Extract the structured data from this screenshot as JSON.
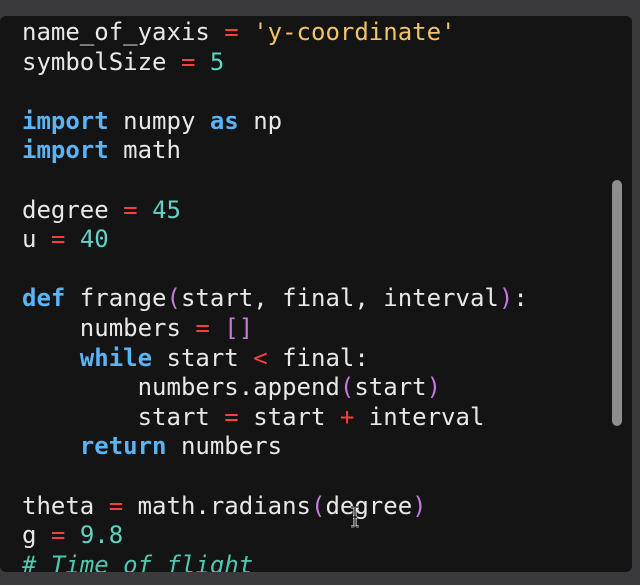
{
  "editor": {
    "lines": [
      {
        "tokens": [
          {
            "t": "name_of_yaxis ",
            "c": ""
          },
          {
            "t": "=",
            "c": "op"
          },
          {
            "t": " ",
            "c": ""
          },
          {
            "t": "'y-coordinate'",
            "c": "str"
          }
        ]
      },
      {
        "tokens": [
          {
            "t": "symbolSize ",
            "c": ""
          },
          {
            "t": "=",
            "c": "op"
          },
          {
            "t": " ",
            "c": ""
          },
          {
            "t": "5",
            "c": "num"
          }
        ]
      },
      {
        "tokens": []
      },
      {
        "tokens": [
          {
            "t": "import",
            "c": "kw"
          },
          {
            "t": " numpy ",
            "c": ""
          },
          {
            "t": "as",
            "c": "kw"
          },
          {
            "t": " np",
            "c": ""
          }
        ]
      },
      {
        "tokens": [
          {
            "t": "import",
            "c": "kw"
          },
          {
            "t": " math",
            "c": ""
          }
        ]
      },
      {
        "tokens": []
      },
      {
        "tokens": [
          {
            "t": "degree ",
            "c": ""
          },
          {
            "t": "=",
            "c": "op"
          },
          {
            "t": " ",
            "c": ""
          },
          {
            "t": "45",
            "c": "num"
          }
        ]
      },
      {
        "tokens": [
          {
            "t": "u ",
            "c": ""
          },
          {
            "t": "=",
            "c": "op"
          },
          {
            "t": " ",
            "c": ""
          },
          {
            "t": "40",
            "c": "num"
          }
        ]
      },
      {
        "tokens": []
      },
      {
        "tokens": [
          {
            "t": "def",
            "c": "kw"
          },
          {
            "t": " frange",
            "c": ""
          },
          {
            "t": "(",
            "c": "br"
          },
          {
            "t": "start, final, interval",
            "c": ""
          },
          {
            "t": ")",
            "c": "br"
          },
          {
            "t": ":",
            "c": ""
          }
        ]
      },
      {
        "tokens": [
          {
            "t": "    numbers ",
            "c": ""
          },
          {
            "t": "=",
            "c": "op"
          },
          {
            "t": " ",
            "c": ""
          },
          {
            "t": "[]",
            "c": "br"
          }
        ]
      },
      {
        "tokens": [
          {
            "t": "    ",
            "c": ""
          },
          {
            "t": "while",
            "c": "kw"
          },
          {
            "t": " start ",
            "c": ""
          },
          {
            "t": "<",
            "c": "op"
          },
          {
            "t": " final:",
            "c": ""
          }
        ]
      },
      {
        "tokens": [
          {
            "t": "        numbers.append",
            "c": ""
          },
          {
            "t": "(",
            "c": "br"
          },
          {
            "t": "start",
            "c": ""
          },
          {
            "t": ")",
            "c": "br"
          }
        ]
      },
      {
        "tokens": [
          {
            "t": "        start ",
            "c": ""
          },
          {
            "t": "=",
            "c": "op"
          },
          {
            "t": " start ",
            "c": ""
          },
          {
            "t": "+",
            "c": "op"
          },
          {
            "t": " interval",
            "c": ""
          }
        ]
      },
      {
        "tokens": [
          {
            "t": "    ",
            "c": ""
          },
          {
            "t": "return",
            "c": "kw"
          },
          {
            "t": " numbers",
            "c": ""
          }
        ]
      },
      {
        "tokens": []
      },
      {
        "tokens": [
          {
            "t": "theta ",
            "c": ""
          },
          {
            "t": "=",
            "c": "op"
          },
          {
            "t": " math.radians",
            "c": ""
          },
          {
            "t": "(",
            "c": "br"
          },
          {
            "t": "degree",
            "c": ""
          },
          {
            "t": ")",
            "c": "br"
          }
        ]
      },
      {
        "tokens": [
          {
            "t": "g ",
            "c": ""
          },
          {
            "t": "=",
            "c": "op"
          },
          {
            "t": " ",
            "c": ""
          },
          {
            "t": "9.8",
            "c": "num"
          }
        ]
      },
      {
        "tokens": [
          {
            "t": "# Time of flight",
            "c": "cmt"
          }
        ]
      }
    ]
  },
  "colors": {
    "keyword": "#5ab4f5",
    "operator": "#f5413d",
    "number": "#5fd3c6",
    "string": "#f2c46a",
    "bracket": "#c678dd",
    "background": "#141414"
  },
  "icons": {
    "cursor": "text-cursor-icon"
  }
}
